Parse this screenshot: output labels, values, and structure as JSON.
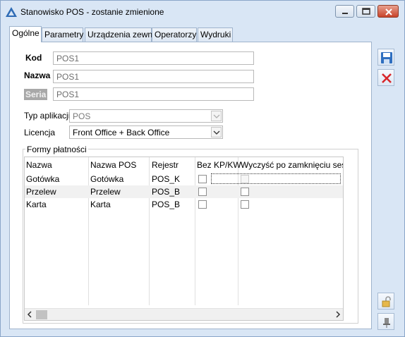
{
  "window": {
    "title": "Stanowisko POS - zostanie zmienione",
    "minimize_icon": "minimize-icon",
    "maximize_icon": "maximize-icon",
    "close_icon": "close-icon"
  },
  "tabs": [
    {
      "label": "Ogólne",
      "active": true
    },
    {
      "label": "Parametry",
      "active": false
    },
    {
      "label": "Urządzenia zewn.",
      "active": false
    },
    {
      "label": "Operatorzy",
      "active": false
    },
    {
      "label": "Wydruki",
      "active": false
    }
  ],
  "form": {
    "kod_label": "Kod",
    "kod_value": "POS1",
    "nazwa_label": "Nazwa",
    "nazwa_value": "POS1",
    "seria_label": "Seria",
    "seria_value": "POS1",
    "typ_label": "Typ aplikacji",
    "typ_value": "POS",
    "licencja_label": "Licencja",
    "licencja_value": "Front Office + Back Office"
  },
  "payments": {
    "group_title": "Formy płatności",
    "columns": [
      "Nazwa",
      "Nazwa POS",
      "Rejestr",
      "Bez KP/KW",
      "Wyczyść po zamknięciu sesji"
    ],
    "rows": [
      {
        "nazwa": "Gotówka",
        "nazwa_pos": "Gotówka",
        "rejestr": "POS_K",
        "bez_kp_kw": false,
        "wyczysc": false
      },
      {
        "nazwa": "Przelew",
        "nazwa_pos": "Przelew",
        "rejestr": "POS_B",
        "bez_kp_kw": false,
        "wyczysc": false
      },
      {
        "nazwa": "Karta",
        "nazwa_pos": "Karta",
        "rejestr": "POS_B",
        "bez_kp_kw": false,
        "wyczysc": false
      }
    ]
  },
  "sidebar": {
    "save_icon": "save-icon",
    "cancel_icon": "cancel-icon",
    "lock_icon": "lock-icon",
    "pin_icon": "pin-icon"
  },
  "colors": {
    "window_bg": "#d9e6f5",
    "close_red": "#c8432a",
    "cancel_red": "#d8262a",
    "save_blue": "#2f6fc0"
  }
}
